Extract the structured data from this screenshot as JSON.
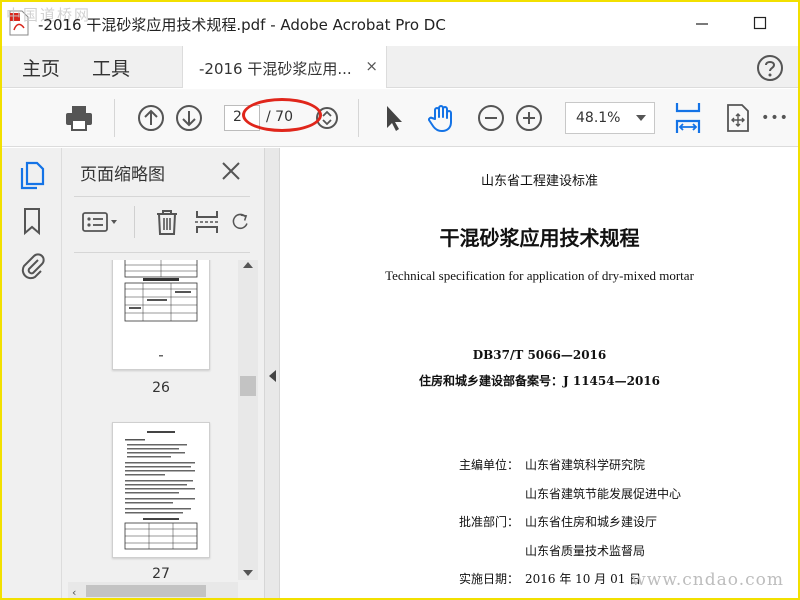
{
  "window": {
    "title": "-2016 干混砂浆应用技术规程.pdf - Adobe Acrobat Pro DC",
    "watermark_top": "中国道桥网",
    "minimize_symbol": "—",
    "maximize_symbol": "☐"
  },
  "menu": {
    "home": "主页",
    "tools": "工具"
  },
  "tab": {
    "label": "-2016 干混砂浆应用...",
    "close": "×"
  },
  "toolbar": {
    "current_page": "2",
    "total_pages": "/ 70",
    "zoom": "48.1%",
    "more": "•••"
  },
  "thumbnails_panel": {
    "title": "页面缩略图",
    "pages": [
      {
        "number": "26"
      },
      {
        "number": "27"
      }
    ]
  },
  "document": {
    "header": "山东省工程建设标准",
    "title": "干混砂浆应用技术规程",
    "subtitle": "Technical specification for application of dry-mixed mortar",
    "standard_no": "DB37/T  5066—2016",
    "record_no": "住房和城乡建设部备案号：J 11454—2016",
    "chief_label": "主编单位：",
    "chief_org_1": "山东省建筑科学研究院",
    "chief_org_2": "山东省建筑节能发展促进中心",
    "approval_label": "批准部门：",
    "approval_org_1": "山东省住房和城乡建设厅",
    "approval_org_2": "山东省质量技术监督局",
    "date_label": "实施日期：",
    "date_value": "2016 年 10 月 01 日"
  },
  "watermark_bottom": "www.cndao.com",
  "colors": {
    "accent_blue": "#1473e6",
    "annotation_red": "#e0261b",
    "frame_yellow": "#f2e000"
  }
}
